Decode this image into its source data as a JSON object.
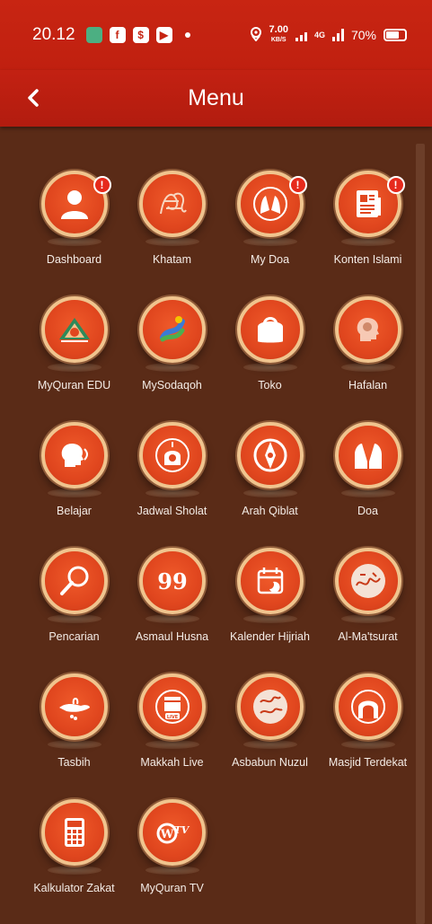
{
  "status_bar": {
    "time": "20.12",
    "speed_value": "7.00",
    "speed_unit": "KB/S",
    "network": "4G",
    "battery": "70%"
  },
  "header": {
    "title": "Menu",
    "back_icon": "chevron-left-icon"
  },
  "menu_items": [
    {
      "label": "Dashboard",
      "icon": "user-icon",
      "badge": "!"
    },
    {
      "label": "Khatam",
      "icon": "quran-calligraphy-icon",
      "badge": ""
    },
    {
      "label": "My Doa",
      "icon": "praying-hands-icon",
      "badge": "!"
    },
    {
      "label": "Konten Islami",
      "icon": "newspaper-icon",
      "badge": "!"
    },
    {
      "label": "MyQuran EDU",
      "icon": "edu-logo-icon",
      "badge": ""
    },
    {
      "label": "MySodaqoh",
      "icon": "sodaqoh-logo-icon",
      "badge": ""
    },
    {
      "label": "Toko",
      "icon": "shopping-bag-icon",
      "badge": ""
    },
    {
      "label": "Hafalan",
      "icon": "head-memory-icon",
      "badge": ""
    },
    {
      "label": "Belajar",
      "icon": "speaking-head-icon",
      "badge": ""
    },
    {
      "label": "Jadwal Sholat",
      "icon": "mosque-clock-icon",
      "badge": ""
    },
    {
      "label": "Arah Qiblat",
      "icon": "compass-icon",
      "badge": ""
    },
    {
      "label": "Doa",
      "icon": "hands-icon",
      "badge": ""
    },
    {
      "label": "Pencarian",
      "icon": "search-icon",
      "badge": ""
    },
    {
      "label": "Asmaul Husna",
      "icon": "99-icon",
      "badge": ""
    },
    {
      "label": "Kalender Hijriah",
      "icon": "calendar-moon-icon",
      "badge": ""
    },
    {
      "label": "Al-Ma'tsurat",
      "icon": "arabic-calligraphy-icon",
      "badge": ""
    },
    {
      "label": "Tasbih",
      "icon": "tasbih-hand-icon",
      "badge": ""
    },
    {
      "label": "Makkah Live",
      "icon": "kaaba-live-icon",
      "badge": ""
    },
    {
      "label": "Asbabun Nuzul",
      "icon": "asbabun-calligraphy-icon",
      "badge": ""
    },
    {
      "label": "Masjid Terdekat",
      "icon": "mosque-location-icon",
      "badge": ""
    },
    {
      "label": "Kalkulator Zakat",
      "icon": "calculator-icon",
      "badge": ""
    },
    {
      "label": "MyQuran TV",
      "icon": "tv-logo-icon",
      "badge": ""
    }
  ],
  "colors": {
    "status_bar": "#c82512",
    "background": "#5a2b17",
    "icon_circle": "#e0461e",
    "icon_ring": "#f0c48e",
    "badge": "#e62a1c"
  }
}
